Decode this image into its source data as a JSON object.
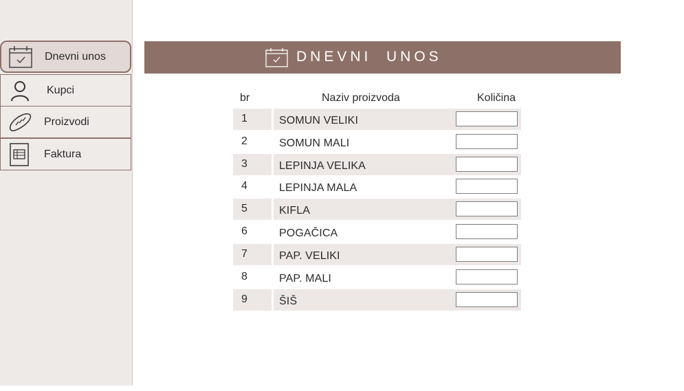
{
  "sidebar": {
    "items": [
      {
        "label": "Dnevni unos",
        "icon": "calendar-check-icon",
        "active": true
      },
      {
        "label": "Kupci",
        "icon": "user-icon",
        "active": false
      },
      {
        "label": "Proizvodi",
        "icon": "bread-icon",
        "active": false
      },
      {
        "label": "Faktura",
        "icon": "invoice-icon",
        "active": false
      }
    ]
  },
  "header": {
    "title": "DNEVNI  UNOS",
    "icon": "calendar-check-icon"
  },
  "table": {
    "columns": {
      "num": "br",
      "name": "Naziv proizvoda",
      "qty": "Količina"
    },
    "rows": [
      {
        "num": "1",
        "name": "SOMUN VELIKI",
        "qty": ""
      },
      {
        "num": "2",
        "name": "SOMUN MALI",
        "qty": ""
      },
      {
        "num": "3",
        "name": "LEPINJA VELIKA",
        "qty": ""
      },
      {
        "num": "4",
        "name": "LEPINJA MALA",
        "qty": ""
      },
      {
        "num": "5",
        "name": "KIFLA",
        "qty": ""
      },
      {
        "num": "6",
        "name": "POGAČICA",
        "qty": ""
      },
      {
        "num": "7",
        "name": "PAP. VELIKI",
        "qty": ""
      },
      {
        "num": "8",
        "name": "PAP. MALI",
        "qty": ""
      },
      {
        "num": "9",
        "name": "ŠIŠ",
        "qty": ""
      }
    ]
  },
  "colors": {
    "accent": "#8d7169",
    "sidebar_bg": "#eeeae8",
    "row_shade": "#ede8e6"
  }
}
